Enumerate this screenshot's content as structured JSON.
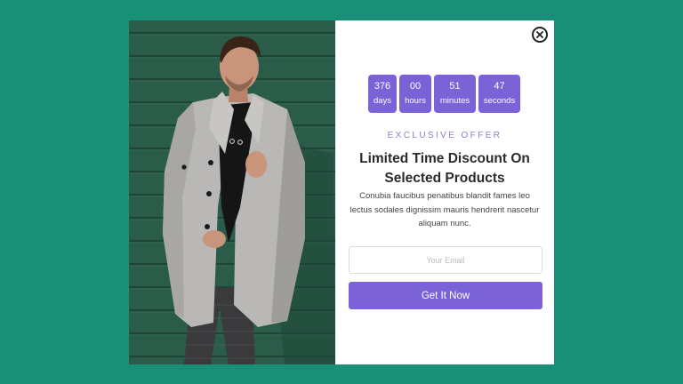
{
  "countdown": [
    {
      "value": "376",
      "unit": "days"
    },
    {
      "value": "00",
      "unit": "hours"
    },
    {
      "value": "51",
      "unit": "minutes"
    },
    {
      "value": "47",
      "unit": "seconds"
    }
  ],
  "offer": {
    "eyebrow": "EXCLUSIVE OFFER",
    "headline_line1": "Limited Time Discount On",
    "headline_line2": "Selected Products",
    "description": "Conubia faucibus penatibus blandit fames leo lectus sodales dignissim mauris hendrerit nascetur aliquam nunc."
  },
  "form": {
    "email_placeholder": "Your Email",
    "submit_label": "Get It Now"
  },
  "icons": {
    "close": "close-icon"
  },
  "colors": {
    "page_background": "#1a8f77",
    "accent": "#7b62d6",
    "eyebrow": "#8b7fcf",
    "wall": "#2a5a48"
  }
}
